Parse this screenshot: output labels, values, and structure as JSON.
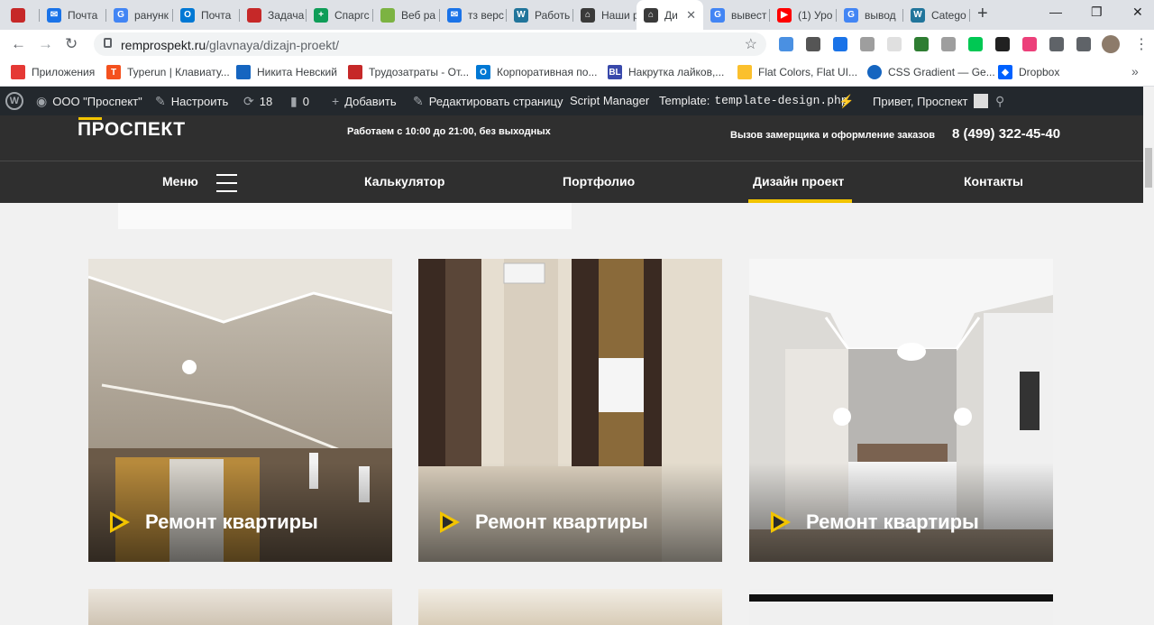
{
  "browser": {
    "tabs": [
      {
        "label": "",
        "color": "#c62828"
      },
      {
        "label": "Почта",
        "color": "#1a73e8"
      },
      {
        "label": "ранунк",
        "color": "#4285f4"
      },
      {
        "label": "Почта",
        "color": "#0078d4"
      },
      {
        "label": "Задача",
        "color": "#c62828"
      },
      {
        "label": "Спаргс",
        "color": "#0f9d58"
      },
      {
        "label": "Веб ра",
        "color": "#7cb342"
      },
      {
        "label": "тз верс",
        "color": "#1a73e8"
      },
      {
        "label": "Работь",
        "color": "#21759b"
      },
      {
        "label": "Наши р",
        "color": "#3a3a3a"
      },
      {
        "label": "Ди",
        "color": "#3a3a3a",
        "active": true
      },
      {
        "label": "вывест",
        "color": "#4285f4"
      },
      {
        "label": "(1) Уро",
        "color": "#ff0000"
      },
      {
        "label": "вывод",
        "color": "#4285f4"
      },
      {
        "label": "Catego",
        "color": "#21759b"
      }
    ],
    "url_host": "remprospekt.ru",
    "url_path": "/glavnaya/dizajn-proekt/",
    "bookmarks": [
      {
        "label": "Приложения",
        "color": "#e53935"
      },
      {
        "label": "Typerun | Клавиату...",
        "color": "#f4511e"
      },
      {
        "label": "Никита Невский",
        "color": "#1565c0"
      },
      {
        "label": "Трудозатраты - От...",
        "color": "#c62828"
      },
      {
        "label": "Корпоративная по...",
        "color": "#0078d4"
      },
      {
        "label": "Накрутка лайков,...",
        "color": "#3949ab"
      },
      {
        "label": "Flat Colors, Flat UI...",
        "color": "#fbc02d"
      },
      {
        "label": "CSS Gradient — Ge...",
        "color": "#1565c0"
      },
      {
        "label": "Dropbox",
        "color": "#0061ff"
      }
    ]
  },
  "wpbar": {
    "site": "ООО \"Проспект\"",
    "customize": "Настроить",
    "updates": "18",
    "comments": "0",
    "add": "Добавить",
    "edit": "Редактировать страницу",
    "script_manager": "Script Manager",
    "template_label": "Template:",
    "template_file": "template-design.php",
    "greeting": "Привет, Проспект"
  },
  "site": {
    "logo": "ПРОСПЕКТ",
    "hours": "Работаем с 10:00 до 21:00, без выходных",
    "callout": "Вызов замерщика и оформление заказов",
    "phone": "8 (499) 322-45-40",
    "nav": {
      "menu": "Меню",
      "calculator": "Калькулятор",
      "portfolio": "Портфолио",
      "design": "Дизайн проект",
      "contacts": "Контакты"
    },
    "accent": "#f2c400",
    "cards": [
      {
        "caption": "Ремонт квартиры"
      },
      {
        "caption": "Ремонт квартиры"
      },
      {
        "caption": "Ремонт квартиры"
      }
    ]
  }
}
